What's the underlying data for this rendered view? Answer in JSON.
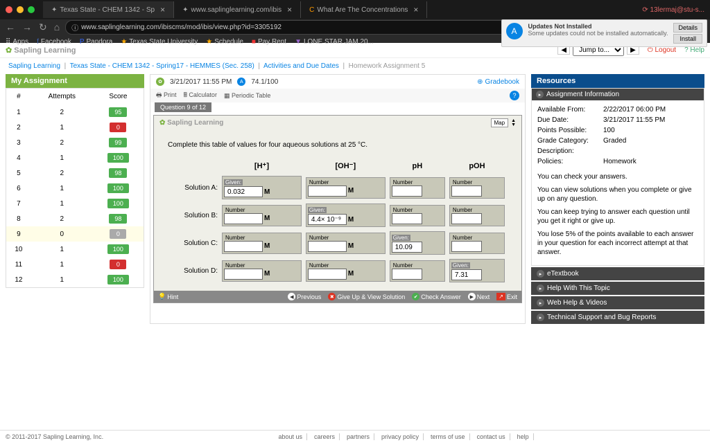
{
  "browser": {
    "tabs": [
      {
        "title": "Texas State - CHEM 1342 - Sp"
      },
      {
        "title": "www.saplinglearning.com/ibis"
      },
      {
        "title": "What Are The Concentrations"
      }
    ],
    "user": "13lermaj@stu-s...",
    "url": "www.saplinglearning.com/ibiscms/mod/ibis/view.php?id=3305192",
    "bookmarks": [
      "Apps",
      "Facebook",
      "Pandora",
      "Texas State University",
      "Schedule",
      "Pay Rent",
      "LONE STAR JAM 20..."
    ],
    "notif": {
      "title": "Updates Not Installed",
      "msg": "Some updates could not be installed automatically.",
      "b1": "Details",
      "b2": "Install"
    }
  },
  "header": {
    "logo1": "Sapling",
    "logo2": "Learning",
    "jump": "Jump to...",
    "logout": "Logout",
    "help": "Help"
  },
  "crumbs": {
    "c1": "Sapling Learning",
    "c2": "Texas State - CHEM 1342 - Spring17 - HEMMES (Sec. 258)",
    "c3": "Activities and Due Dates",
    "c4": "Homework Assignment 5"
  },
  "left": {
    "title": "My Assignment",
    "h1": "#",
    "h2": "Attempts",
    "h3": "Score",
    "rows": [
      {
        "n": "1",
        "a": "2",
        "s": "95",
        "c": "sp-g"
      },
      {
        "n": "2",
        "a": "1",
        "s": "0",
        "c": "sp-r"
      },
      {
        "n": "3",
        "a": "2",
        "s": "99",
        "c": "sp-g"
      },
      {
        "n": "4",
        "a": "1",
        "s": "100",
        "c": "sp-g"
      },
      {
        "n": "5",
        "a": "2",
        "s": "98",
        "c": "sp-g"
      },
      {
        "n": "6",
        "a": "1",
        "s": "100",
        "c": "sp-g"
      },
      {
        "n": "7",
        "a": "1",
        "s": "100",
        "c": "sp-g"
      },
      {
        "n": "8",
        "a": "2",
        "s": "98",
        "c": "sp-g"
      },
      {
        "n": "9",
        "a": "0",
        "s": "0",
        "c": "sp-y",
        "hi": true
      },
      {
        "n": "10",
        "a": "1",
        "s": "100",
        "c": "sp-g"
      },
      {
        "n": "11",
        "a": "1",
        "s": "0",
        "c": "sp-r"
      },
      {
        "n": "12",
        "a": "1",
        "s": "100",
        "c": "sp-g"
      }
    ]
  },
  "center": {
    "due": "3/21/2017 11:55 PM",
    "pts": "74.1/100",
    "gradebook": "Gradebook",
    "tools": {
      "print": "Print",
      "calc": "Calculator",
      "pt": "Periodic Table"
    },
    "qtab": "Question 9 of 12",
    "brand1": "Sapling",
    "brand2": "Learning",
    "map": "Map",
    "instr": "Complete this table of values for four aqueous solutions at 25 °C.",
    "cols": {
      "h": "[H⁺]",
      "oh": "[OH⁻]",
      "ph": "pH",
      "poh": "pOH"
    },
    "labs": {
      "given": "Given:",
      "num": "Number"
    },
    "rows": {
      "a": {
        "lab": "Solution A:",
        "h": "0.032"
      },
      "b": {
        "lab": "Solution B:",
        "oh": "4.4× 10⁻⁹"
      },
      "c": {
        "lab": "Solution C:",
        "ph": "10.09"
      },
      "d": {
        "lab": "Solution D:",
        "poh": "7.31"
      }
    },
    "unit": "M",
    "foot": {
      "hint": "Hint",
      "prev": "Previous",
      "give": "Give Up & View Solution",
      "check": "Check Answer",
      "next": "Next",
      "exit": "Exit"
    }
  },
  "right": {
    "title": "Resources",
    "sub": "Assignment Information",
    "info": [
      {
        "k": "Available From:",
        "v": "2/22/2017 06:00 PM"
      },
      {
        "k": "Due Date:",
        "v": "3/21/2017 11:55 PM"
      },
      {
        "k": "Points Possible:",
        "v": "100"
      },
      {
        "k": "Grade Category:",
        "v": "Graded"
      },
      {
        "k": "Description:",
        "v": ""
      },
      {
        "k": "Policies:",
        "v": "Homework"
      }
    ],
    "pol": [
      "You can check your answers.",
      "You can view solutions when you complete or give up on any question.",
      "You can keep trying to answer each question until you get it right or give up.",
      "You lose 5% of the points available to each answer in your question for each incorrect attempt at that answer."
    ],
    "links": [
      "eTextbook",
      "Help With This Topic",
      "Web Help & Videos",
      "Technical Support and Bug Reports"
    ]
  },
  "footer": {
    "copy": "© 2011-2017 Sapling Learning, Inc.",
    "links": [
      "about us",
      "careers",
      "partners",
      "privacy policy",
      "terms of use",
      "contact us",
      "help"
    ]
  }
}
